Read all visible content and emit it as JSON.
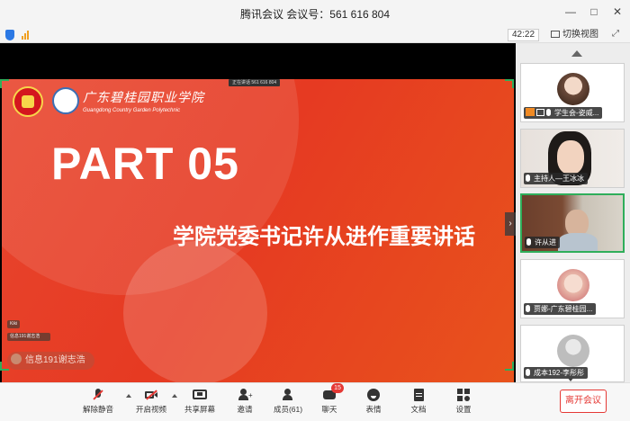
{
  "window": {
    "title": "腾讯会议 会议号：561 616 804",
    "controls": [
      "—",
      "□",
      "✕"
    ]
  },
  "topbar": {
    "timer": "42:22",
    "switch_view": "切换视图"
  },
  "slide": {
    "school_cn": "广东碧桂园职业学院",
    "school_en": "Guangdong Country Garden Polytechnic",
    "share_tag": "正在讲话 561 616 804",
    "part": "PART 05",
    "headline": "学院党委书记许从进作重要讲话",
    "mini_tags": [
      "Kiki",
      "信息191谢志浩"
    ],
    "active_speaker": "信息191谢志浩"
  },
  "participants": [
    {
      "name": "学生会-姿威...",
      "type": "avatar-photo",
      "active": false
    },
    {
      "name": "主持人—王冰冰",
      "type": "camera",
      "active": false
    },
    {
      "name": "许从进",
      "type": "camera",
      "active": true
    },
    {
      "name": "贾娜-广东碧桂园...",
      "type": "avatar-photo",
      "active": false
    },
    {
      "name": "成本192-李彤彤",
      "type": "avatar-default",
      "active": false
    }
  ],
  "toolbar": {
    "items": [
      {
        "label": "解除静音",
        "icon": "mic-muted-icon"
      },
      {
        "label": "开启视频",
        "icon": "video-off-icon"
      },
      {
        "label": "共享屏幕",
        "icon": "share-screen-icon"
      },
      {
        "label": "邀请",
        "icon": "invite-icon"
      },
      {
        "label": "成员(61)",
        "icon": "members-icon"
      },
      {
        "label": "聊天",
        "icon": "chat-icon",
        "badge": "15"
      },
      {
        "label": "表情",
        "icon": "emoji-icon"
      },
      {
        "label": "文档",
        "icon": "document-icon"
      },
      {
        "label": "设置",
        "icon": "settings-icon"
      }
    ],
    "leave": "离开会议"
  },
  "colors": {
    "slide_red": "#e63a22",
    "active_green": "#2fae5b",
    "leave_red": "#e53935"
  }
}
